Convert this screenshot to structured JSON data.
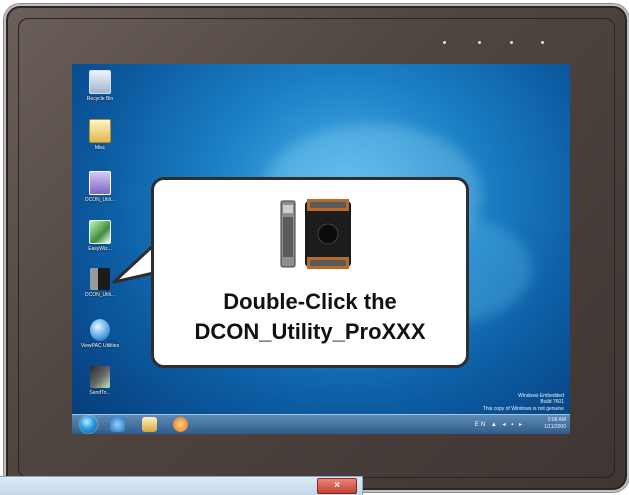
{
  "desktop": {
    "icons": [
      {
        "label": "Recycle Bin",
        "icon": "recycle-bin-icon"
      },
      {
        "label": "Misc",
        "icon": "folder-icon"
      },
      {
        "label": "DCON_Utili...",
        "icon": "dcon-shortcut-icon"
      },
      {
        "label": "EasyWiz...",
        "icon": "app-icon"
      },
      {
        "label": "DCON_Utili...",
        "icon": "dcon-utility-pro-icon"
      },
      {
        "label": "ViewPAC Utilities",
        "icon": "viewpac-icon"
      },
      {
        "label": "SendTo...",
        "icon": "program-icon"
      }
    ],
    "watermark": {
      "line1": "Windows Embedded",
      "line2": "Build 7601",
      "line3": "This copy of Windows is not genuine"
    }
  },
  "taskbar": {
    "time": "2:08 AM",
    "date": "1/11/2000",
    "tray_icons": "EN ▲ ◂ ▪ ▸"
  },
  "callout": {
    "line1": "Double-Click the",
    "line2": "DCON_Utility_ProXXX"
  },
  "dialog": {
    "close_label": "×"
  },
  "colors": {
    "bezel": "#4f4541",
    "desktop": "#1b7fc4",
    "callout_border": "#2e2e2e",
    "close_button": "#c4402f"
  }
}
